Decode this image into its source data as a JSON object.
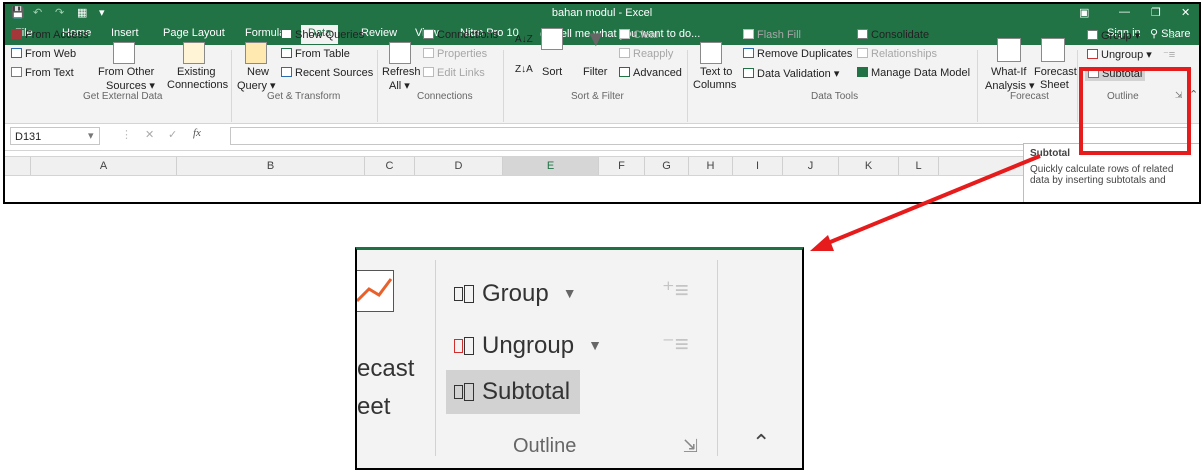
{
  "app": {
    "title": "bahan modul - Excel",
    "sign_in": "Sign in",
    "share": "Share"
  },
  "tabs": [
    "File",
    "Home",
    "Insert",
    "Page Layout",
    "Formulas",
    "Data",
    "Review",
    "View",
    "Nitro Pro 10"
  ],
  "active_tab": "Data",
  "tell_me": "Tell me what you want to do...",
  "ribbon": {
    "get_external": {
      "label": "Get External Data",
      "from_access": "From Access",
      "from_web": "From Web",
      "from_text": "From Text",
      "from_other_1": "From Other",
      "from_other_2": "Sources",
      "existing_1": "Existing",
      "existing_2": "Connections"
    },
    "get_transform": {
      "label": "Get & Transform",
      "new_query_1": "New",
      "new_query_2": "Query",
      "show_queries": "Show Queries",
      "from_table": "From Table",
      "recent_sources": "Recent Sources"
    },
    "connections": {
      "label": "Connections",
      "refresh_1": "Refresh",
      "refresh_2": "All",
      "connections": "Connections",
      "properties": "Properties",
      "edit_links": "Edit Links"
    },
    "sort_filter": {
      "label": "Sort & Filter",
      "sort": "Sort",
      "filter": "Filter",
      "clear": "Clear",
      "reapply": "Reapply",
      "advanced": "Advanced"
    },
    "data_tools": {
      "label": "Data Tools",
      "text_to_1": "Text to",
      "text_to_2": "Columns",
      "flash_fill": "Flash Fill",
      "remove_duplicates": "Remove Duplicates",
      "data_validation": "Data Validation",
      "consolidate": "Consolidate",
      "relationships": "Relationships",
      "manage_data_model": "Manage Data Model"
    },
    "forecast": {
      "label": "Forecast",
      "what_if_1": "What-If",
      "what_if_2": "Analysis",
      "forecast_1": "Forecast",
      "forecast_2": "Sheet"
    },
    "outline": {
      "label": "Outline",
      "group": "Group",
      "ungroup": "Ungroup",
      "subtotal": "Subtotal"
    }
  },
  "formula_bar": {
    "name_box": "D131",
    "fx": "fx"
  },
  "columns": [
    "A",
    "B",
    "C",
    "D",
    "E",
    "F",
    "G",
    "H",
    "I",
    "J",
    "K",
    "L"
  ],
  "tooltip": {
    "title": "Subtotal",
    "body": "Quickly calculate rows of related data by inserting subtotals and"
  },
  "zoom": {
    "forecast_1": "ecast",
    "forecast_2": "eet",
    "group": "Group",
    "ungroup": "Ungroup",
    "subtotal": "Subtotal",
    "outline": "Outline"
  },
  "colors": {
    "excel_green": "#217346",
    "highlight_red": "#e61b1b"
  }
}
